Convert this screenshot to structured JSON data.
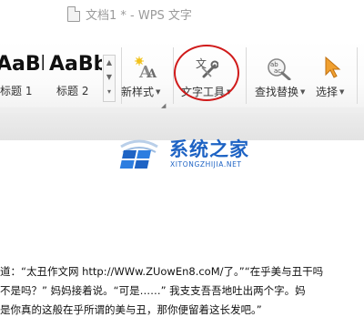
{
  "window": {
    "title": "文档1 * - WPS 文字"
  },
  "ribbon": {
    "styles": [
      {
        "sample": "AaBb",
        "name": "标题 1"
      },
      {
        "sample": "AaBbC",
        "name": "标题 2"
      }
    ],
    "new_style": {
      "label": "新样式",
      "icon": "new-style-icon"
    },
    "text_tools": {
      "label": "文字工具",
      "icon": "wrench-pen-icon"
    },
    "find_replace": {
      "label": "查找替换",
      "icon": "find-replace-icon"
    },
    "select": {
      "label": "选择",
      "icon": "cursor-icon"
    },
    "annotation_color": "#d01a1a"
  },
  "watermark": {
    "name": "系统之家",
    "url": "XITONGZHIJIA.NET",
    "color": "#1e63c4"
  },
  "document": {
    "lines": [
      "道：“太丑作文网 http://WWw.ZUowEn8.coM/了。”“在乎美与丑干吗",
      "不是吗？” 妈妈接着说。“可是……” 我支支吾吾地吐出两个字。妈",
      "是你真的这般在乎所谓的美与丑，那你便留着这长发吧。”"
    ]
  }
}
